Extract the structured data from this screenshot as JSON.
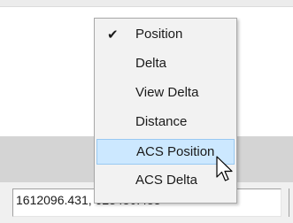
{
  "menu": {
    "items": [
      {
        "label": "Position",
        "checked": true,
        "highlighted": false
      },
      {
        "label": "Delta",
        "checked": false,
        "highlighted": false
      },
      {
        "label": "View Delta",
        "checked": false,
        "highlighted": false
      },
      {
        "label": "Distance",
        "checked": false,
        "highlighted": false
      },
      {
        "label": "ACS Position",
        "checked": false,
        "highlighted": true
      },
      {
        "label": "ACS Delta",
        "checked": false,
        "highlighted": false
      }
    ],
    "check_glyph": "✔",
    "highlight_color": "#cce8ff"
  },
  "status_bar": {
    "coordinates": "1612096.431, 628480.483"
  },
  "cursor": {
    "icon": "arrow-pointer-icon"
  }
}
